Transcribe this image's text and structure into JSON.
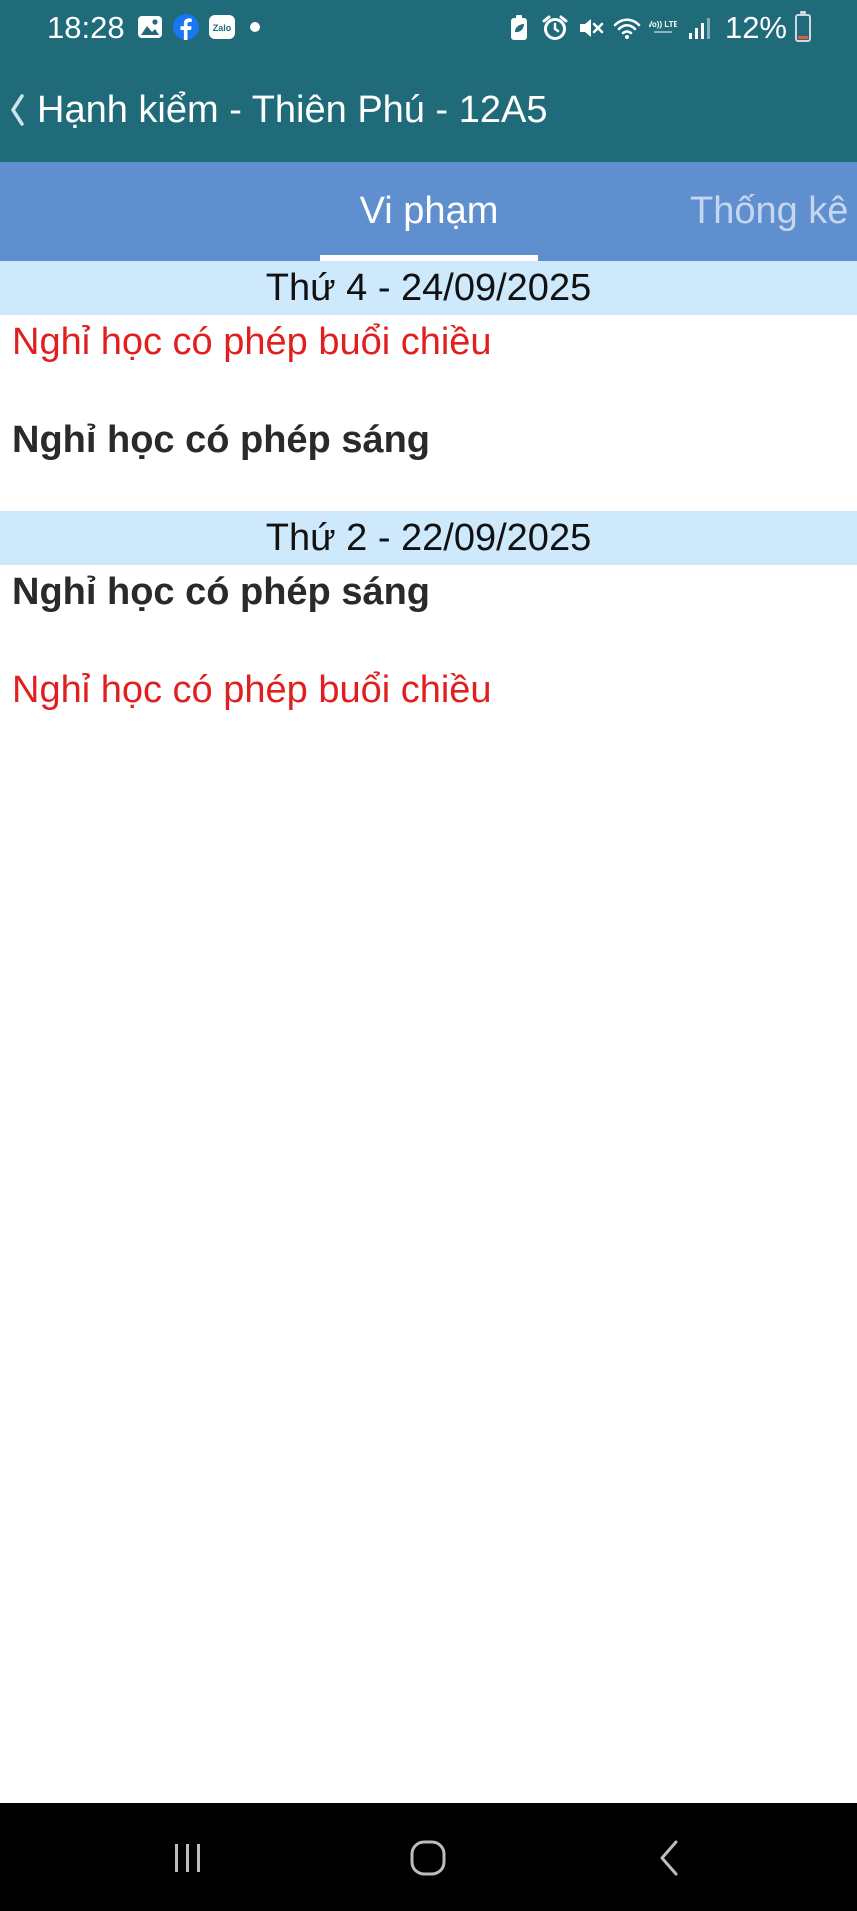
{
  "status_bar": {
    "time": "18:28",
    "notification_icons": [
      "gallery-icon",
      "facebook-icon",
      "zalo-icon",
      "more-dot-icon"
    ],
    "zalo_label": "Zalo",
    "system_icons": [
      "battery-saver-icon",
      "alarm-icon",
      "mute-icon",
      "wifi-icon",
      "volte-icon",
      "signal-icon"
    ],
    "volte_label": "Vo)) LTE",
    "battery_percent": "12%",
    "battery_level": 0.12
  },
  "app_bar": {
    "back_icon": "chevron-left-icon",
    "title": "Hạnh kiểm - Thiên Phú - 12A5"
  },
  "tabs": [
    {
      "label": "Vi phạm",
      "active": true
    },
    {
      "label": "Thống kê",
      "active": false
    }
  ],
  "sections": [
    {
      "date": "Thứ 4 - 24/09/2025",
      "entries": [
        {
          "text": "Nghỉ học có phép buổi chiều",
          "style": "red"
        },
        {
          "text": "Nghỉ học có phép sáng",
          "style": "bold-dark"
        }
      ]
    },
    {
      "date": "Thứ 2 - 22/09/2025",
      "entries": [
        {
          "text": "Nghỉ học có phép sáng",
          "style": "bold-dark"
        },
        {
          "text": "Nghỉ học có phép buổi chiều",
          "style": "red"
        }
      ]
    }
  ],
  "colors": {
    "app_bar": "#1f6b7a",
    "tab_bar": "#5f8fcf",
    "date_header": "#cde9fb",
    "entry_red": "#e11f1f",
    "entry_dark": "#2a2a2a"
  },
  "nav_bar": {
    "buttons": [
      "recent-apps-icon",
      "home-icon",
      "back-icon"
    ]
  }
}
